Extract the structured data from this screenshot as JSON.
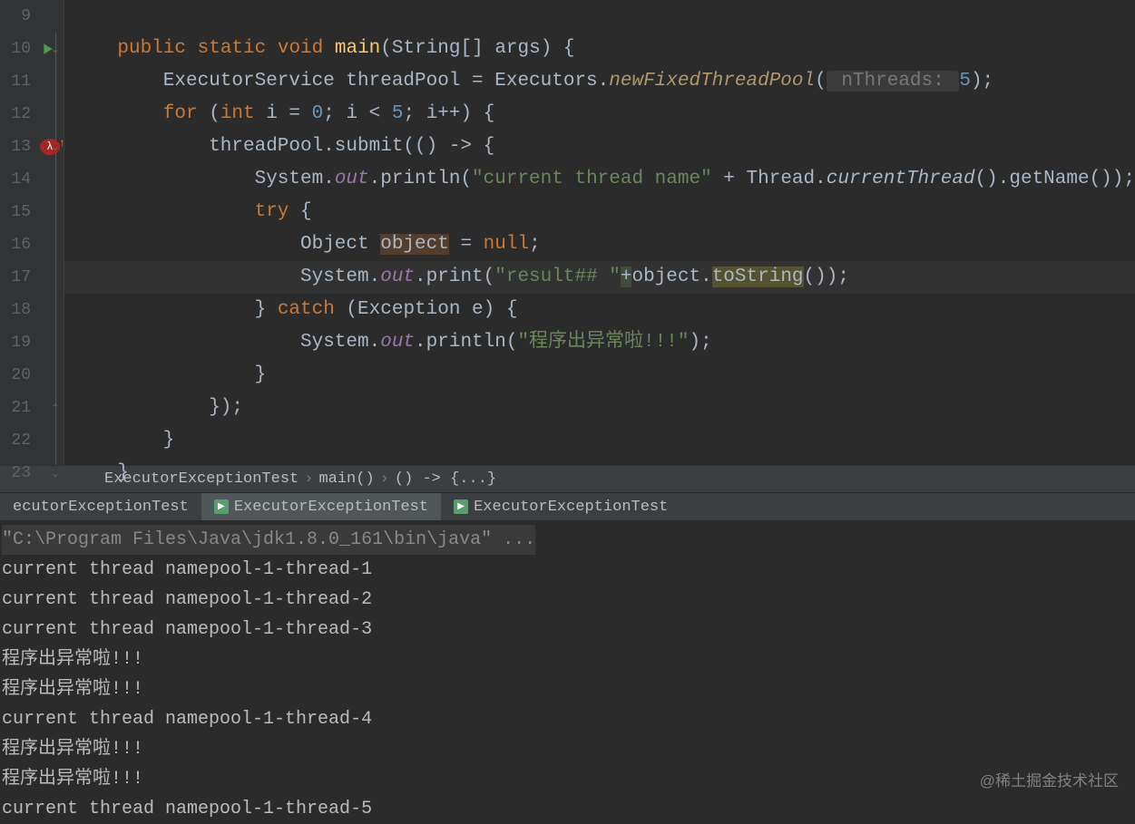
{
  "gutter": {
    "lines": [
      {
        "num": "9"
      },
      {
        "num": "10",
        "run": true,
        "fold": "down"
      },
      {
        "num": "11"
      },
      {
        "num": "12"
      },
      {
        "num": "13",
        "lambda": true,
        "fold": "down"
      },
      {
        "num": "14"
      },
      {
        "num": "15"
      },
      {
        "num": "16"
      },
      {
        "num": "17"
      },
      {
        "num": "18"
      },
      {
        "num": "19"
      },
      {
        "num": "20"
      },
      {
        "num": "21",
        "fold": "up"
      },
      {
        "num": "22"
      },
      {
        "num": "23",
        "fold": "down"
      }
    ]
  },
  "code": {
    "l9": "",
    "l10_kw1": "public",
    "l10_kw2": "static",
    "l10_kw3": "void",
    "l10_m": "main",
    "l10_rest": "(String[] args) {",
    "l11_a": "ExecutorService threadPool = Executors.",
    "l11_m": "newFixedThreadPool",
    "l11_b": "(",
    "l11_hint": " nThreads: ",
    "l11_c": "5",
    "l11_d": ");",
    "l12_a": "for",
    "l12_b": " (",
    "l12_c": "int",
    "l12_d": " i = ",
    "l12_e": "0",
    "l12_f": "; i < ",
    "l12_g": "5",
    "l12_h": "; i++) {",
    "l13": "threadPool.submit(() -> {",
    "l14_a": "System.",
    "l14_b": "out",
    "l14_c": ".println(",
    "l14_d": "\"current thread name\"",
    "l14_e": " + Thread.",
    "l14_f": "currentThread",
    "l14_g": "().getName());",
    "l15_a": "try",
    "l15_b": " {",
    "l16_a": "Object ",
    "l16_b": "object",
    "l16_c": " = ",
    "l16_d": "null",
    "l16_e": ";",
    "l17_a": "System.",
    "l17_b": "out",
    "l17_c": ".print(",
    "l17_d": "\"result## \"",
    "l17_e": "+",
    "l17_f": "object.",
    "l17_g": "toString",
    "l17_h": "());",
    "l18_a": "} ",
    "l18_b": "catch",
    "l18_c": " (Exception e) {",
    "l19_a": "System.",
    "l19_b": "out",
    "l19_c": ".println(",
    "l19_d": "\"程序出异常啦!!!\"",
    "l19_e": ");",
    "l20": "}",
    "l21": "});",
    "l22": "}",
    "l23": "}"
  },
  "breadcrumb": {
    "items": [
      "ExecutorExceptionTest",
      "main()",
      "() -> {...}"
    ]
  },
  "tabs": {
    "items": [
      "ecutorExceptionTest",
      "ExecutorExceptionTest",
      "ExecutorExceptionTest"
    ]
  },
  "console": {
    "cmd": "\"C:\\Program Files\\Java\\jdk1.8.0_161\\bin\\java\" ...",
    "lines": [
      "current thread namepool-1-thread-1",
      "current thread namepool-1-thread-2",
      "current thread namepool-1-thread-3",
      "程序出异常啦!!!",
      "程序出异常啦!!!",
      "current thread namepool-1-thread-4",
      "程序出异常啦!!!",
      "程序出异常啦!!!",
      "current thread namepool-1-thread-5"
    ]
  },
  "watermark": "@稀土掘金技术社区"
}
